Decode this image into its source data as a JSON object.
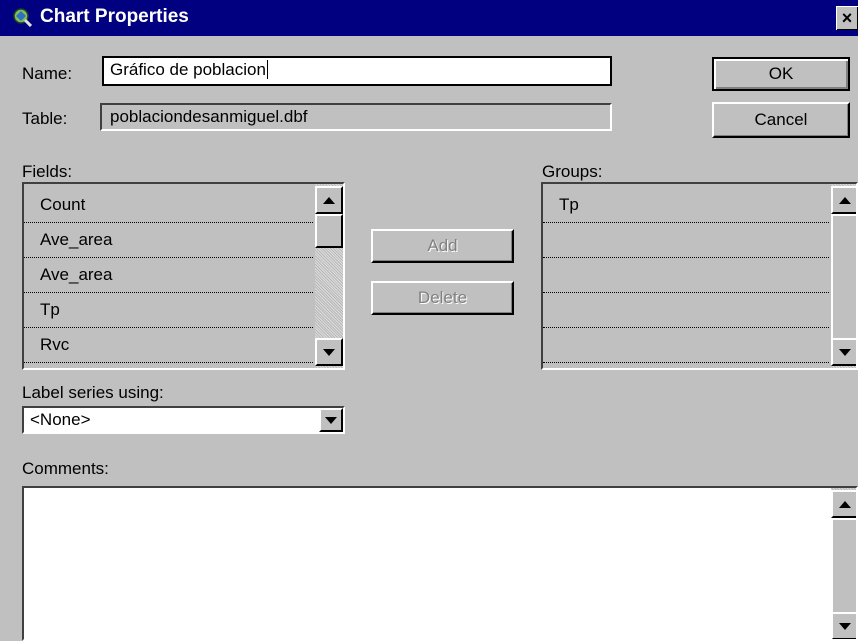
{
  "window": {
    "title": "Chart Properties",
    "close_glyph": "×"
  },
  "form": {
    "name_label": "Name:",
    "name_value": "Gráfico de poblacion",
    "table_label": "Table:",
    "table_value": "poblaciondesanmiguel.dbf"
  },
  "buttons": {
    "ok": "OK",
    "cancel": "Cancel",
    "add": "Add",
    "delete": "Delete"
  },
  "fields": {
    "label": "Fields:",
    "items": [
      "Count",
      "Ave_area",
      "Ave_area",
      "Tp",
      "Rvc"
    ]
  },
  "groups": {
    "label": "Groups:",
    "items": [
      "Tp",
      "",
      "",
      "",
      ""
    ]
  },
  "label_series": {
    "label": "Label series using:",
    "value": "<None>"
  },
  "comments": {
    "label": "Comments:",
    "value": ""
  },
  "icons": {
    "app": "chart-app-icon",
    "close": "close-icon",
    "up": "scroll-up-icon",
    "down": "scroll-down-icon",
    "dropdown": "chevron-down-icon"
  },
  "colors": {
    "titlebar": "#000080",
    "face": "#c0c0c0",
    "field_bg": "#ffffff",
    "disabled_text": "#808080"
  }
}
